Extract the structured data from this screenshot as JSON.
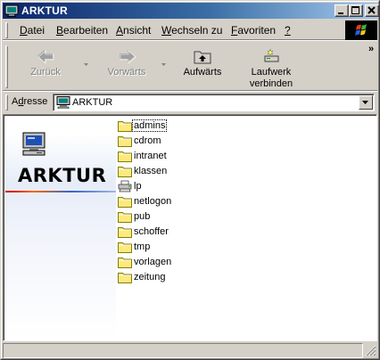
{
  "window": {
    "title": "ARKTUR",
    "icon": "folder-window-icon"
  },
  "menu": {
    "items": [
      {
        "label": "Datei",
        "accel": "D"
      },
      {
        "label": "Bearbeiten",
        "accel": "B"
      },
      {
        "label": "Ansicht",
        "accel": "A"
      },
      {
        "label": "Wechseln zu",
        "accel": "W"
      },
      {
        "label": "Favoriten",
        "accel": "F"
      },
      {
        "label": "?",
        "accel": "?"
      }
    ]
  },
  "toolbar": {
    "back_label": "Zurück",
    "forward_label": "Vorwärts",
    "up_label": "Aufwärts",
    "map_drive_label_1": "Laufwerk",
    "map_drive_label_2": "verbinden",
    "more": "»"
  },
  "address": {
    "label": "Adresse",
    "value": "ARKTUR"
  },
  "webview": {
    "title": "ARKTUR"
  },
  "files": [
    {
      "name": "admins",
      "type": "folder",
      "focused": true
    },
    {
      "name": "cdrom",
      "type": "folder"
    },
    {
      "name": "intranet",
      "type": "folder"
    },
    {
      "name": "klassen",
      "type": "folder"
    },
    {
      "name": "lp",
      "type": "printer"
    },
    {
      "name": "netlogon",
      "type": "folder"
    },
    {
      "name": "pub",
      "type": "folder"
    },
    {
      "name": "schoffer",
      "type": "folder"
    },
    {
      "name": "tmp",
      "type": "folder"
    },
    {
      "name": "vorlagen",
      "type": "folder"
    },
    {
      "name": "zeitung",
      "type": "folder"
    }
  ],
  "colors": {
    "titlebar_start": "#0a246a",
    "titlebar_end": "#a6caf0",
    "face": "#d4d0c8",
    "folder": "#ffe97f"
  }
}
